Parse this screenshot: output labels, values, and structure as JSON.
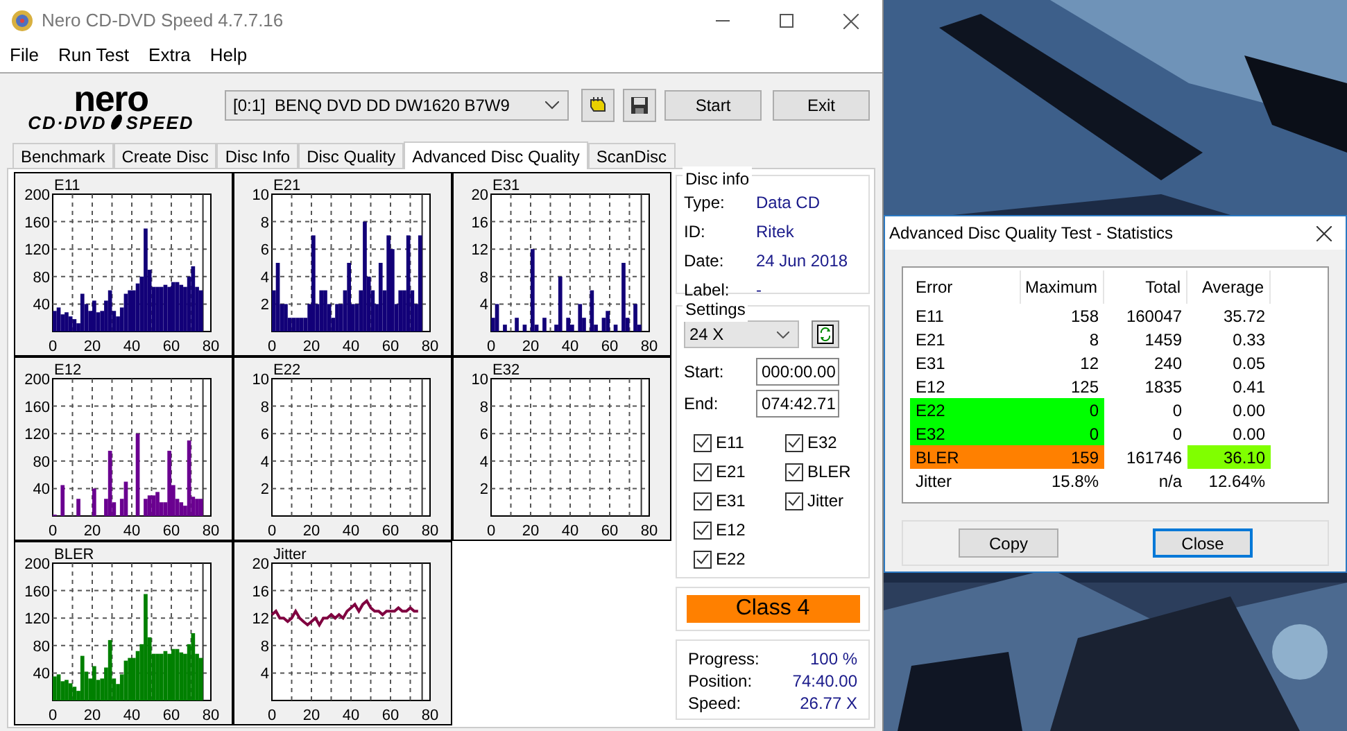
{
  "window": {
    "title": "Nero CD-DVD Speed 4.7.7.16"
  },
  "menu": [
    "File",
    "Run Test",
    "Extra",
    "Help"
  ],
  "logo": {
    "brand": "nero",
    "product_left": "CD·DVD",
    "product_right": "SPEED"
  },
  "toolbar": {
    "drive": "[0:1]  BENQ DVD DD DW1620 B7W9",
    "buttons": [
      "Start",
      "Exit"
    ]
  },
  "tabs": [
    {
      "label": "Benchmark",
      "selected": false
    },
    {
      "label": "Create Disc",
      "selected": false
    },
    {
      "label": "Disc Info",
      "selected": false
    },
    {
      "label": "Disc Quality",
      "selected": false
    },
    {
      "label": "Advanced Disc Quality",
      "selected": true
    },
    {
      "label": "ScanDisc",
      "selected": false
    }
  ],
  "charts": [
    {
      "chart_data": {
        "type": "bar",
        "title": "E11",
        "xlim": [
          0,
          80
        ],
        "ylim": [
          0,
          200
        ],
        "xticks": [
          0,
          20,
          40,
          60,
          80
        ],
        "yticks": [
          40,
          80,
          120,
          160,
          200
        ],
        "x": [
          0,
          2,
          4,
          6,
          8,
          10,
          12,
          14,
          16,
          18,
          20,
          22,
          24,
          26,
          28,
          30,
          32,
          34,
          36,
          38,
          40,
          42,
          44,
          46,
          48,
          50,
          52,
          54,
          56,
          58,
          60,
          62,
          64,
          66,
          68,
          70,
          72,
          74
        ],
        "grid": true,
        "ref_lines": [
          {
            "axis": "x",
            "value": 76
          }
        ],
        "series": [
          {
            "color": "#120078",
            "values": [
              30,
              35,
              25,
              28,
              22,
              18,
              12,
              55,
              40,
              30,
              45,
              28,
              30,
              45,
              60,
              30,
              22,
              35,
              55,
              60,
              60,
              70,
              80,
              150,
              90,
              65,
              65,
              65,
              68,
              65,
              72,
              72,
              68,
              65,
              80,
              95,
              65,
              60
            ]
          }
        ]
      }
    },
    {
      "chart_data": {
        "type": "bar",
        "title": "E21",
        "xlim": [
          0,
          80
        ],
        "ylim": [
          0,
          10
        ],
        "xticks": [
          0,
          20,
          40,
          60,
          80
        ],
        "yticks": [
          2,
          4,
          6,
          8,
          10
        ],
        "x": [
          0,
          2,
          4,
          6,
          8,
          10,
          12,
          14,
          16,
          18,
          20,
          22,
          24,
          26,
          28,
          30,
          32,
          34,
          36,
          38,
          40,
          42,
          44,
          46,
          48,
          50,
          52,
          54,
          56,
          58,
          60,
          62,
          64,
          66,
          68,
          70,
          72,
          74
        ],
        "grid": true,
        "ref_lines": [
          {
            "axis": "x",
            "value": 76
          }
        ],
        "series": [
          {
            "color": "#120078",
            "values": [
              3,
              5,
              2,
              2,
              1,
              1,
              1,
              1,
              1,
              2,
              7,
              2,
              3,
              3,
              2,
              1,
              2,
              2,
              3,
              5,
              2,
              2,
              3,
              8,
              4,
              3,
              2,
              5,
              3,
              7,
              6,
              2,
              3,
              3,
              7,
              3,
              2,
              7
            ]
          }
        ]
      }
    },
    {
      "chart_data": {
        "type": "bar",
        "title": "E31",
        "xlim": [
          0,
          80
        ],
        "ylim": [
          0,
          20
        ],
        "xticks": [
          0,
          20,
          40,
          60,
          80
        ],
        "yticks": [
          4,
          8,
          12,
          16,
          20
        ],
        "x": [
          0,
          2,
          4,
          6,
          8,
          10,
          12,
          14,
          16,
          18,
          20,
          22,
          24,
          26,
          28,
          30,
          32,
          34,
          36,
          38,
          40,
          42,
          44,
          46,
          48,
          50,
          52,
          54,
          56,
          58,
          60,
          62,
          64,
          66,
          68,
          70,
          72,
          74
        ],
        "grid": true,
        "ref_lines": [
          {
            "axis": "x",
            "value": 76
          }
        ],
        "series": [
          {
            "color": "#120078",
            "values": [
              2,
              4,
              0,
              1,
              0,
              0,
              2,
              0,
              1,
              0,
              12,
              1,
              0,
              2,
              0,
              0,
              1,
              8,
              0,
              2,
              1,
              0,
              4,
              2,
              0,
              6,
              1,
              0,
              2,
              3,
              0,
              1,
              0,
              10,
              2,
              0,
              4,
              1
            ]
          }
        ]
      }
    },
    {
      "chart_data": {
        "type": "bar",
        "title": "E12",
        "xlim": [
          0,
          80
        ],
        "ylim": [
          0,
          200
        ],
        "xticks": [
          0,
          20,
          40,
          60,
          80
        ],
        "yticks": [
          40,
          80,
          120,
          160,
          200
        ],
        "x": [
          0,
          2,
          4,
          6,
          8,
          10,
          12,
          14,
          16,
          18,
          20,
          22,
          24,
          26,
          28,
          30,
          32,
          34,
          36,
          38,
          40,
          42,
          44,
          46,
          48,
          50,
          52,
          54,
          56,
          58,
          60,
          62,
          64,
          66,
          68,
          70,
          72,
          74
        ],
        "grid": true,
        "ref_lines": [
          {
            "axis": "x",
            "value": 76
          }
        ],
        "series": [
          {
            "color": "#6a0090",
            "values": [
              2,
              0,
              45,
              0,
              0,
              0,
              25,
              0,
              0,
              0,
              40,
              0,
              0,
              25,
              95,
              20,
              0,
              25,
              50,
              0,
              0,
              120,
              0,
              25,
              30,
              30,
              35,
              20,
              20,
              95,
              45,
              25,
              20,
              15,
              110,
              28,
              25,
              25
            ]
          }
        ]
      }
    },
    {
      "chart_data": {
        "type": "bar",
        "title": "E22",
        "xlim": [
          0,
          80
        ],
        "ylim": [
          0,
          10
        ],
        "xticks": [
          0,
          20,
          40,
          60,
          80
        ],
        "yticks": [
          2,
          4,
          6,
          8,
          10
        ],
        "x": [
          0,
          2,
          4,
          6,
          8,
          10,
          12,
          14,
          16,
          18,
          20,
          22,
          24,
          26,
          28,
          30,
          32,
          34,
          36,
          38,
          40,
          42,
          44,
          46,
          48,
          50,
          52,
          54,
          56,
          58,
          60,
          62,
          64,
          66,
          68,
          70,
          72,
          74
        ],
        "grid": true,
        "ref_lines": [
          {
            "axis": "x",
            "value": 76
          }
        ],
        "series": [
          {
            "values": [
              0,
              0,
              0,
              0,
              0,
              0,
              0,
              0,
              0,
              0,
              0,
              0,
              0,
              0,
              0,
              0,
              0,
              0,
              0,
              0,
              0,
              0,
              0,
              0,
              0,
              0,
              0,
              0,
              0,
              0,
              0,
              0,
              0,
              0,
              0,
              0,
              0,
              0
            ]
          }
        ]
      }
    },
    {
      "chart_data": {
        "type": "bar",
        "title": "E32",
        "xlim": [
          0,
          80
        ],
        "ylim": [
          0,
          10
        ],
        "xticks": [
          0,
          20,
          40,
          60,
          80
        ],
        "yticks": [
          2,
          4,
          6,
          8,
          10
        ],
        "x": [
          0,
          2,
          4,
          6,
          8,
          10,
          12,
          14,
          16,
          18,
          20,
          22,
          24,
          26,
          28,
          30,
          32,
          34,
          36,
          38,
          40,
          42,
          44,
          46,
          48,
          50,
          52,
          54,
          56,
          58,
          60,
          62,
          64,
          66,
          68,
          70,
          72,
          74
        ],
        "grid": true,
        "ref_lines": [
          {
            "axis": "x",
            "value": 76
          }
        ],
        "series": [
          {
            "values": [
              0,
              0,
              0,
              0,
              0,
              0,
              0,
              0,
              0,
              0,
              0,
              0,
              0,
              0,
              0,
              0,
              0,
              0,
              0,
              0,
              0,
              0,
              0,
              0,
              0,
              0,
              0,
              0,
              0,
              0,
              0,
              0,
              0,
              0,
              0,
              0,
              0,
              0
            ]
          }
        ]
      }
    },
    {
      "chart_data": {
        "type": "bar",
        "title": "BLER",
        "xlim": [
          0,
          80
        ],
        "ylim": [
          0,
          200
        ],
        "xticks": [
          0,
          20,
          40,
          60,
          80
        ],
        "yticks": [
          40,
          80,
          120,
          160,
          200
        ],
        "x": [
          0,
          2,
          4,
          6,
          8,
          10,
          12,
          14,
          16,
          18,
          20,
          22,
          24,
          26,
          28,
          30,
          32,
          34,
          36,
          38,
          40,
          42,
          44,
          46,
          48,
          50,
          52,
          54,
          56,
          58,
          60,
          62,
          64,
          66,
          68,
          70,
          72,
          74
        ],
        "grid": true,
        "ref_lines": [
          {
            "axis": "x",
            "value": 76
          }
        ],
        "series": [
          {
            "color": "#008000",
            "values": [
              35,
              38,
              28,
              30,
              25,
              20,
              14,
              65,
              42,
              32,
              50,
              30,
              32,
              48,
              88,
              32,
              24,
              38,
              58,
              62,
              62,
              72,
              82,
              155,
              92,
              68,
              68,
              68,
              72,
              68,
              75,
              75,
              70,
              68,
              82,
              98,
              68,
              62
            ]
          }
        ]
      }
    },
    {
      "chart_data": {
        "type": "line",
        "title": "Jitter",
        "xlim": [
          0,
          80
        ],
        "ylim": [
          0,
          20
        ],
        "xticks": [
          0,
          20,
          40,
          60,
          80
        ],
        "yticks": [
          4,
          8,
          12,
          16,
          20
        ],
        "x": [
          0,
          2,
          4,
          6,
          8,
          10,
          12,
          14,
          16,
          18,
          20,
          22,
          24,
          26,
          28,
          30,
          32,
          34,
          36,
          38,
          40,
          42,
          44,
          46,
          48,
          50,
          52,
          54,
          56,
          58,
          60,
          62,
          64,
          66,
          68,
          70,
          72,
          74
        ],
        "grid": true,
        "ref_lines": [
          {
            "axis": "x",
            "value": 76
          }
        ],
        "series": [
          {
            "color": "#800040",
            "values": [
              12.5,
              13,
              12,
              12,
              11.5,
              12,
              13,
              12,
              11.5,
              11,
              11.5,
              12,
              11,
              12,
              12,
              12.5,
              12,
              12.5,
              12,
              13,
              13.5,
              14,
              13,
              14,
              14.5,
              13.5,
              13,
              13,
              12.5,
              13,
              13,
              13,
              13.5,
              13,
              13,
              13.5,
              13,
              13
            ]
          }
        ]
      }
    }
  ],
  "disc_info": {
    "title": "Disc info",
    "fields": [
      {
        "label": "Type:",
        "value": "Data CD"
      },
      {
        "label": "ID:",
        "value": "Ritek"
      },
      {
        "label": "Date:",
        "value": "24 Jun 2018"
      },
      {
        "label": "Label:",
        "value": "-"
      }
    ]
  },
  "settings": {
    "title": "Settings",
    "speed": "24 X",
    "start_label": "Start:",
    "start": "000:00.00",
    "end_label": "End:",
    "end": "074:42.71",
    "checks": [
      {
        "label": "E11",
        "checked": true
      },
      {
        "label": "E21",
        "checked": true
      },
      {
        "label": "E31",
        "checked": true
      },
      {
        "label": "E12",
        "checked": true
      },
      {
        "label": "E22",
        "checked": true
      },
      {
        "label": "E32",
        "checked": true
      },
      {
        "label": "BLER",
        "checked": true
      },
      {
        "label": "Jitter",
        "checked": true
      }
    ]
  },
  "class_badge": {
    "text": "Class 4",
    "color": "#ff8000"
  },
  "progress": [
    {
      "label": "Progress:",
      "value": "100 %"
    },
    {
      "label": "Position:",
      "value": "74:40.00"
    },
    {
      "label": "Speed:",
      "value": "26.77 X"
    }
  ],
  "stats_dialog": {
    "title": "Advanced Disc Quality Test - Statistics",
    "columns": [
      "Error",
      "Maximum",
      "Total",
      "Average"
    ],
    "rows": [
      {
        "cells": [
          {
            "text": "E11"
          },
          {
            "text": "158"
          },
          {
            "text": "160047"
          },
          {
            "text": "35.72"
          }
        ]
      },
      {
        "cells": [
          {
            "text": "E21"
          },
          {
            "text": "8"
          },
          {
            "text": "1459"
          },
          {
            "text": "0.33"
          }
        ]
      },
      {
        "cells": [
          {
            "text": "E31"
          },
          {
            "text": "12"
          },
          {
            "text": "240"
          },
          {
            "text": "0.05"
          }
        ]
      },
      {
        "cells": [
          {
            "text": "E12"
          },
          {
            "text": "125"
          },
          {
            "text": "1835"
          },
          {
            "text": "0.41"
          }
        ]
      },
      {
        "cells": [
          {
            "text": "E22",
            "color": "#00ff00"
          },
          {
            "text": "0",
            "color": "#00ff00"
          },
          {
            "text": "0"
          },
          {
            "text": "0.00"
          }
        ]
      },
      {
        "cells": [
          {
            "text": "E32",
            "color": "#00ff00"
          },
          {
            "text": "0",
            "color": "#00ff00"
          },
          {
            "text": "0"
          },
          {
            "text": "0.00"
          }
        ]
      },
      {
        "cells": [
          {
            "text": "BLER",
            "color": "#ff8000"
          },
          {
            "text": "159",
            "color": "#ff8000"
          },
          {
            "text": "161746"
          },
          {
            "text": "36.10",
            "color": "#80ff00"
          }
        ]
      },
      {
        "cells": [
          {
            "text": "Jitter"
          },
          {
            "text": "15.8%"
          },
          {
            "text": "n/a"
          },
          {
            "text": "12.64%"
          }
        ]
      }
    ],
    "buttons": [
      {
        "label": "Copy",
        "selected": false
      },
      {
        "label": "Close",
        "selected": true
      }
    ]
  }
}
